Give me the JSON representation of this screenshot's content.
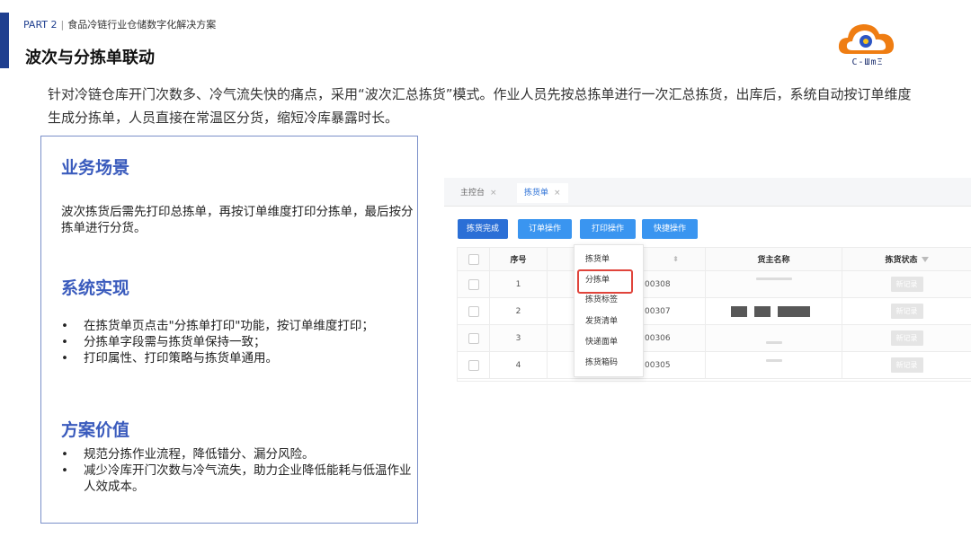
{
  "header": {
    "part": "PART 2",
    "separator": "|",
    "subtitle": "食品冷链行业仓储数字化解决方案",
    "title": "波次与分拣单联动"
  },
  "logo": {
    "text": "C-ШmΞ"
  },
  "intro": "针对冷链仓库开门次数多、冷气流失快的痛点，采用“波次汇总拣货”模式。作业人员先按总拣单进行一次汇总拣货，出库后，系统自动按订单维度生成分拣单，人员直接在常温区分货，缩短冷库暴露时长。",
  "card": {
    "scenario": {
      "title": "业务场景",
      "text": "波次拣货后需先打印总拣单，再按订单维度打印分拣单，最后按分拣单进行分货。"
    },
    "implementation": {
      "title": "系统实现",
      "items": [
        "在拣货单页点击\"分拣单打印\"功能，按订单维度打印；",
        "分拣单字段需与拣货单保持一致；",
        "打印属性、打印策略与拣货单通用。"
      ]
    },
    "value": {
      "title": "方案价值",
      "items": [
        "规范分拣作业流程，降低错分、漏分风险。",
        "减少冷库开门次数与冷气流失，助力企业降低能耗与低温作业人效成本。"
      ]
    }
  },
  "app": {
    "tabs": [
      {
        "label": "主控台",
        "close": "×"
      },
      {
        "label": "拣货单",
        "close": "×"
      }
    ],
    "buttons": [
      "拣货完成",
      "订单操作",
      "打印操作",
      "快捷操作"
    ],
    "columns": {
      "seq": "序号",
      "owner": "货主名称",
      "status": "拣货状态"
    },
    "rows": [
      {
        "seq": "1",
        "code": "00308",
        "status": "新记录"
      },
      {
        "seq": "2",
        "code": "00307",
        "status": "新记录"
      },
      {
        "seq": "3",
        "code": "00306",
        "status": "新记录"
      },
      {
        "seq": "4",
        "code": "00305",
        "status": "新记录"
      }
    ],
    "dropdown": [
      "拣货单",
      "分拣单",
      "拣货标签",
      "发货清单",
      "快递面单",
      "拣货箱码"
    ],
    "highlighted_item": "分拣单",
    "colors": {
      "primary": "#2b6fd6",
      "highlight_border": "#e0443b",
      "section_title": "#3a5bbd",
      "accent_bar": "#1f3f8f"
    }
  }
}
